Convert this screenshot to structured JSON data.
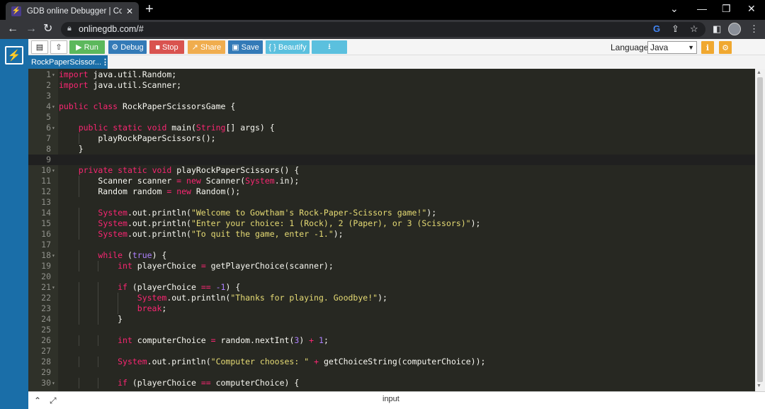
{
  "browser": {
    "tab_title": "GDB online Debugger | Compiler - Co",
    "tab_close": "✕",
    "new_tab": "+",
    "url": "onlinegdb.com/#",
    "window_controls": {
      "collapse": "⌄",
      "minimize": "—",
      "restore": "❐",
      "close": "✕"
    },
    "nav": {
      "back": "←",
      "forward": "→",
      "reload": "↻"
    }
  },
  "toolbar": {
    "run": "▶ Run",
    "debug": "⚙ Debug",
    "stop": "■ Stop",
    "share": "↗ Share",
    "save": "▣ Save",
    "beautify": "{ } Beautify",
    "download": "⭳",
    "language_label": "Language",
    "language_value": "Java",
    "colors": {
      "run": "#5cb85c",
      "debug": "#337ab7",
      "stop": "#d9534f",
      "share": "#f0ad4e",
      "save": "#337ab7",
      "beautify": "#5bc0de",
      "download": "#5bc0de"
    }
  },
  "file_tab": {
    "name": "RockPaperScissor...",
    "menu": "⋮"
  },
  "editor": {
    "lines": [
      {
        "n": "1",
        "fold": true,
        "html": "<span class='k'>import</span> java.util.Random;"
      },
      {
        "n": "2",
        "fold": false,
        "html": "<span class='k'>import</span> java.util.Scanner;"
      },
      {
        "n": "3",
        "fold": false,
        "html": ""
      },
      {
        "n": "4",
        "fold": true,
        "html": "<span class='k'>public</span> <span class='k'>class</span> RockPaperScissorsGame {"
      },
      {
        "n": "5",
        "fold": false,
        "html": ""
      },
      {
        "n": "6",
        "fold": true,
        "html": "    <span class='k'>public</span> <span class='k'>static</span> <span class='k'>void</span> main(<span class='st'>String</span>[] args) {"
      },
      {
        "n": "7",
        "fold": false,
        "html": "        playRockPaperScissors();"
      },
      {
        "n": "8",
        "fold": false,
        "html": "    }"
      },
      {
        "n": "9",
        "fold": false,
        "html": "",
        "active": true
      },
      {
        "n": "10",
        "fold": true,
        "html": "    <span class='k'>private</span> <span class='k'>static</span> <span class='k'>void</span> playRockPaperScissors() {"
      },
      {
        "n": "11",
        "fold": false,
        "html": "        Scanner scanner <span class='o'>=</span> <span class='k'>new</span> Scanner(<span class='st'>System</span>.in);"
      },
      {
        "n": "12",
        "fold": false,
        "html": "        Random random <span class='o'>=</span> <span class='k'>new</span> Random();"
      },
      {
        "n": "13",
        "fold": false,
        "html": ""
      },
      {
        "n": "14",
        "fold": false,
        "html": "        <span class='st'>System</span>.out.println(<span class='s'>\"Welcome to Gowtham's Rock-Paper-Scissors game!\"</span>);"
      },
      {
        "n": "15",
        "fold": false,
        "html": "        <span class='st'>System</span>.out.println(<span class='s'>\"Enter your choice: 1 (Rock), 2 (Paper), or 3 (Scissors)\"</span>);"
      },
      {
        "n": "16",
        "fold": false,
        "html": "        <span class='st'>System</span>.out.println(<span class='s'>\"To quit the game, enter -1.\"</span>);"
      },
      {
        "n": "17",
        "fold": false,
        "html": ""
      },
      {
        "n": "18",
        "fold": true,
        "html": "        <span class='k'>while</span> (<span class='bl'>true</span>) {"
      },
      {
        "n": "19",
        "fold": false,
        "html": "            <span class='k'>int</span> playerChoice <span class='o'>=</span> getPlayerChoice(scanner);"
      },
      {
        "n": "20",
        "fold": false,
        "html": ""
      },
      {
        "n": "21",
        "fold": true,
        "html": "            <span class='k'>if</span> (playerChoice <span class='o'>==</span> <span class='n'>-1</span>) {"
      },
      {
        "n": "22",
        "fold": false,
        "html": "                <span class='st'>System</span>.out.println(<span class='s'>\"Thanks for playing. Goodbye!\"</span>);"
      },
      {
        "n": "23",
        "fold": false,
        "html": "                <span class='k'>break</span>;"
      },
      {
        "n": "24",
        "fold": false,
        "html": "            }"
      },
      {
        "n": "25",
        "fold": false,
        "html": ""
      },
      {
        "n": "26",
        "fold": false,
        "html": "            <span class='k'>int</span> computerChoice <span class='o'>=</span> random.nextInt(<span class='n'>3</span>) <span class='o'>+</span> <span class='n'>1</span>;"
      },
      {
        "n": "27",
        "fold": false,
        "html": ""
      },
      {
        "n": "28",
        "fold": false,
        "html": "            <span class='st'>System</span>.out.println(<span class='s'>\"Computer chooses: \"</span> <span class='o'>+</span> getChoiceString(computerChoice));"
      },
      {
        "n": "29",
        "fold": false,
        "html": ""
      },
      {
        "n": "30",
        "fold": true,
        "html": "            <span class='k'>if</span> (playerChoice <span class='o'>==</span> computerChoice) {"
      }
    ]
  },
  "bottom": {
    "input_label": "input",
    "collapse_icon": "⌃",
    "expand_icon": "⤢"
  }
}
